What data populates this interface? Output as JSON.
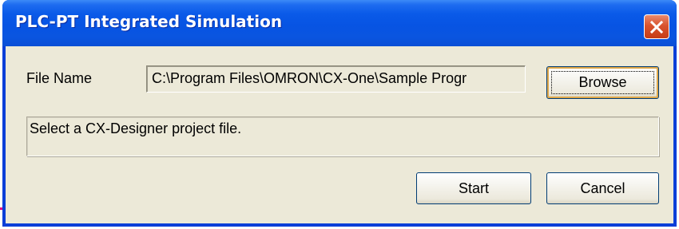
{
  "window": {
    "title": "PLC-PT Integrated Simulation"
  },
  "form": {
    "file_name_label": "File Name",
    "file_name_value": "C:\\Program Files\\OMRON\\CX-One\\Sample Progr",
    "browse_label": "Browse",
    "status_message": "Select a CX-Designer project file."
  },
  "buttons": {
    "start_label": "Start",
    "cancel_label": "Cancel"
  },
  "icons": {
    "close": "close-icon"
  },
  "colors": {
    "titlebar": "#0754e3",
    "close_button": "#d9532e",
    "dialog_background": "#ece9d8",
    "accent_mark": "#e6007e"
  }
}
